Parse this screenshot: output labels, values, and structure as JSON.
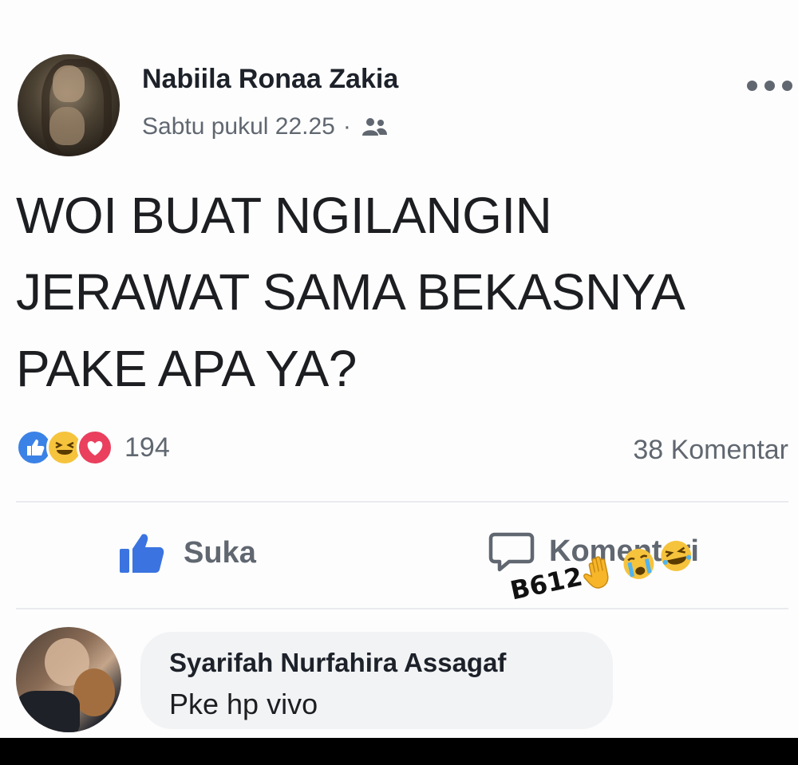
{
  "post": {
    "author": "Nabiila Ronaa Zakia",
    "timestamp": "Sabtu pukul 22.25",
    "separator": "·",
    "audience_icon": "friends-icon",
    "more_icon": "more-options-icon",
    "text_lines": [
      "WOI BUAT NGILANGIN",
      "JERAWAT SAMA BEKASNYA",
      "PAKE APA YA?"
    ]
  },
  "reactions": {
    "types": [
      "like-icon",
      "haha-icon",
      "love-icon"
    ],
    "count": "194",
    "comments_count": "38 Komentar"
  },
  "actions": {
    "like_label": "Suka",
    "comment_label": "Komentari"
  },
  "watermark": {
    "text": "B612",
    "emojis": [
      "raised-hand-emoji",
      "crying-face-emoji",
      "laughing-face-emoji"
    ]
  },
  "comment": {
    "author": "Syarifah Nurfahira Assagaf",
    "text": "Pke hp vivo"
  },
  "colors": {
    "like_blue": "#3b82e6",
    "haha_yellow": "#f6c33d",
    "love_red": "#ea3f5d",
    "secondary_text": "#606770"
  }
}
